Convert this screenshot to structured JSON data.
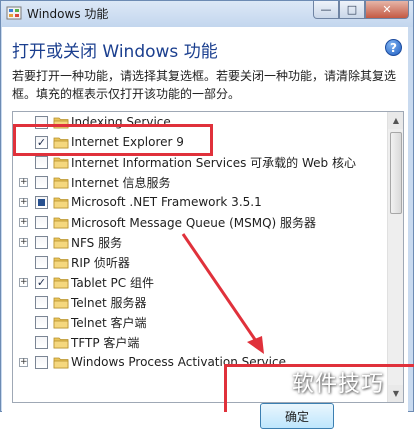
{
  "window": {
    "title": "Windows 功能",
    "controls": {
      "minimize": "—",
      "maximize": "□",
      "close": "✕"
    }
  },
  "header": {
    "heading": "打开或关闭 Windows 功能",
    "help": "?",
    "description": "若要打开一种功能，请选择其复选框。若要关闭一种功能，请清除其复选框。填充的框表示仅打开该功能的一部分。"
  },
  "features": [
    {
      "label": "Indexing Service",
      "checked": false,
      "expandable": false
    },
    {
      "label": "Internet Explorer 9",
      "checked": true,
      "expandable": false
    },
    {
      "label": "Internet Information Services 可承载的 Web 核心",
      "checked": false,
      "expandable": false
    },
    {
      "label": "Internet 信息服务",
      "checked": false,
      "expandable": true
    },
    {
      "label": "Microsoft .NET Framework 3.5.1",
      "checked": "partial",
      "expandable": true
    },
    {
      "label": "Microsoft Message Queue (MSMQ) 服务器",
      "checked": false,
      "expandable": true
    },
    {
      "label": "NFS 服务",
      "checked": false,
      "expandable": true
    },
    {
      "label": "RIP 侦听器",
      "checked": false,
      "expandable": false
    },
    {
      "label": "Tablet PC 组件",
      "checked": true,
      "expandable": true
    },
    {
      "label": "Telnet 服务器",
      "checked": false,
      "expandable": false
    },
    {
      "label": "Telnet 客户端",
      "checked": false,
      "expandable": false
    },
    {
      "label": "TFTP 客户端",
      "checked": false,
      "expandable": false
    },
    {
      "label": "Windows Process Activation Service",
      "checked": false,
      "expandable": true
    }
  ],
  "buttons": {
    "ok": "确定"
  },
  "watermark": "软件技巧",
  "colors": {
    "heading": "#1b3f8f",
    "annotation_red": "#e0313b",
    "folder": "#e8c35a"
  }
}
